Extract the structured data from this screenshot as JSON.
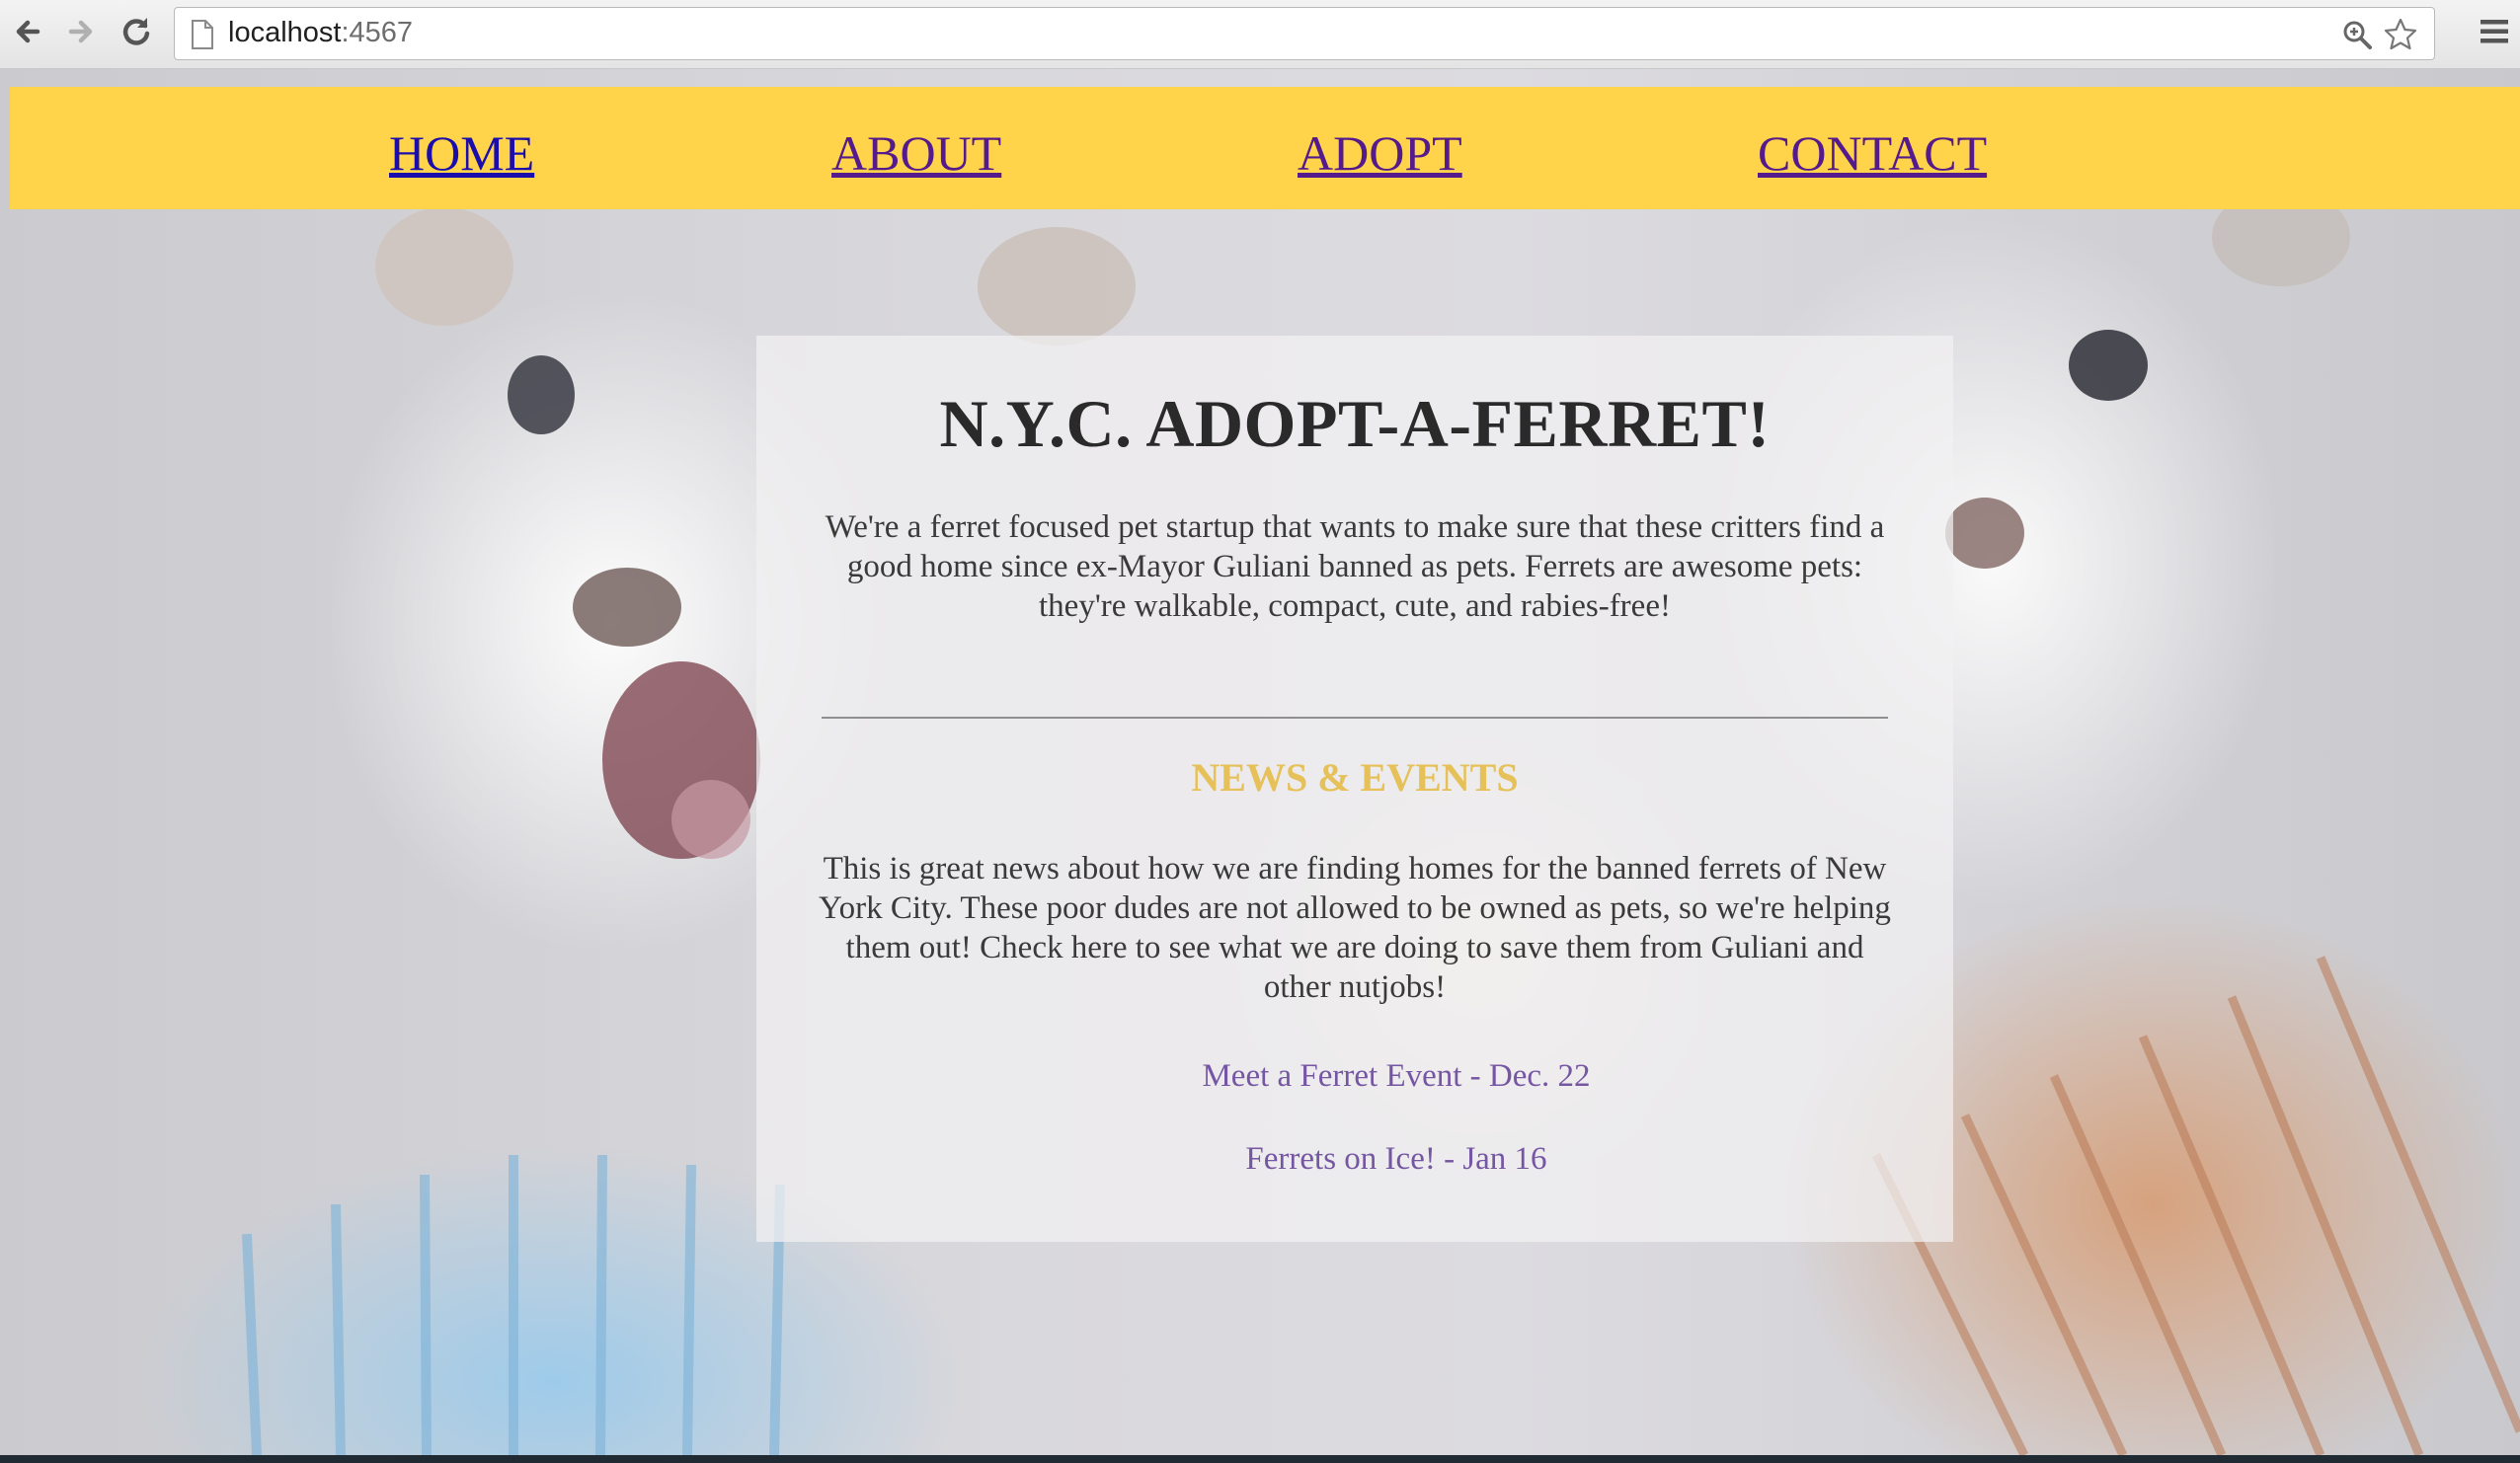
{
  "browser": {
    "url_host": "localhost",
    "url_port": ":4567",
    "icons": {
      "back": "back-arrow-icon",
      "forward": "forward-arrow-icon",
      "reload": "reload-icon",
      "page": "page-icon",
      "zoom": "zoom-icon",
      "bookmark": "star-icon",
      "menu": "hamburger-menu-icon"
    }
  },
  "nav": {
    "items": [
      {
        "label": "HOME",
        "color": "#1a0dab"
      },
      {
        "label": "ABOUT",
        "color": "#551a8b"
      },
      {
        "label": "ADOPT",
        "color": "#551a8b"
      },
      {
        "label": "CONTACT",
        "color": "#551a8b"
      }
    ],
    "background": "#ffd44b"
  },
  "main": {
    "title": "N.Y.C. ADOPT-A-FERRET!",
    "intro": "We're a ferret focused pet startup that wants to make sure that these critters find a good home since ex-Mayor Guliani banned as pets. Ferrets are awesome pets: they're walkable, compact, cute, and rabies-free!",
    "news_heading": "NEWS & EVENTS",
    "news_body": "This is great news about how we are finding homes for the banned ferrets of New York City. These poor dudes are not allowed to be owned as pets, so we're helping them out! Check here to see what we are doing to save them from Guliani and other nutjobs!",
    "events": [
      {
        "label": "Meet a Ferret Event - Dec. 22"
      },
      {
        "label": "Ferrets on Ice! - Jan 16"
      }
    ],
    "colors": {
      "heading": "#e6c058",
      "event_link": "#7556a3"
    }
  }
}
